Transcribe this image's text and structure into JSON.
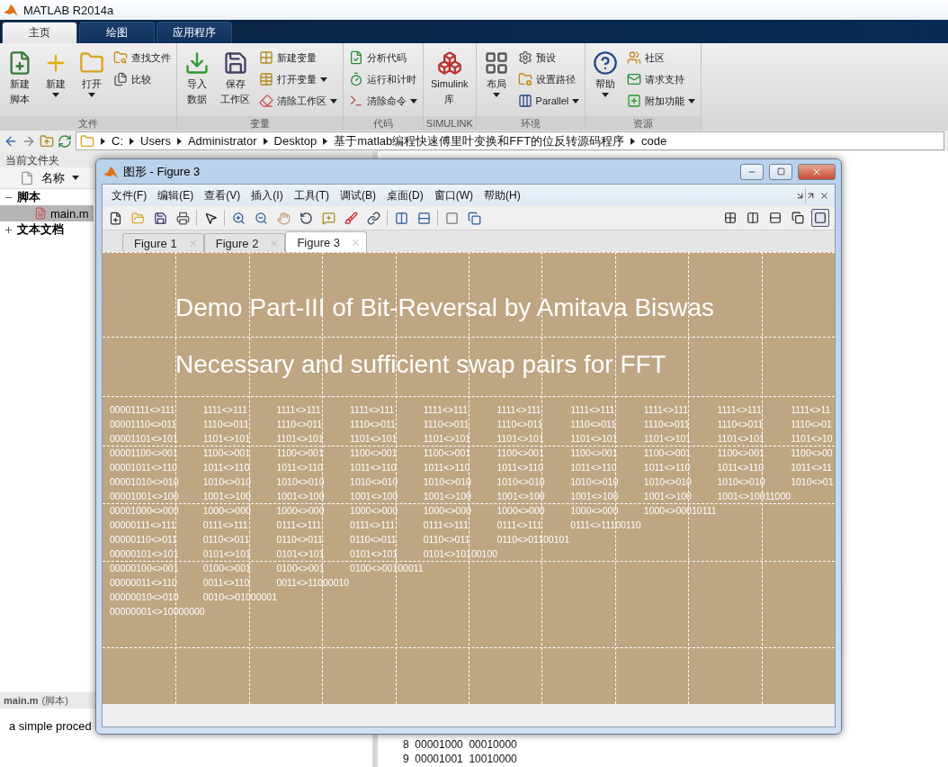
{
  "window": {
    "title": "MATLAB R2014a"
  },
  "ribbon_tabs": [
    {
      "label": "主页",
      "selected": true
    },
    {
      "label": "绘图",
      "selected": false
    },
    {
      "label": "应用程序",
      "selected": false
    }
  ],
  "ribbon_groups": [
    {
      "label": "文件",
      "items": [
        {
          "kind": "large",
          "lines": [
            "新建",
            "脚本"
          ],
          "dropdown": false
        },
        {
          "kind": "large",
          "lines": [
            "新建"
          ],
          "dropdown": true
        },
        {
          "kind": "large",
          "lines": [
            "打开"
          ],
          "dropdown": true
        },
        {
          "kind": "stack",
          "items": [
            {
              "label": "查找文件",
              "dropdown": false
            },
            {
              "label": "比较",
              "dropdown": false
            }
          ]
        }
      ]
    },
    {
      "label": "变量",
      "items": [
        {
          "kind": "large",
          "lines": [
            "导入",
            "数据"
          ],
          "dropdown": false
        },
        {
          "kind": "large",
          "lines": [
            "保存",
            "工作区"
          ],
          "dropdown": false
        },
        {
          "kind": "stack",
          "items": [
            {
              "label": "新建变量",
              "dropdown": false
            },
            {
              "label": "打开变量",
              "dropdown": true
            },
            {
              "label": "清除工作区",
              "dropdown": true
            }
          ]
        }
      ]
    },
    {
      "label": "代码",
      "items": [
        {
          "kind": "stack",
          "items": [
            {
              "label": "分析代码",
              "dropdown": false
            },
            {
              "label": "运行和计时",
              "dropdown": false
            },
            {
              "label": "清除命令",
              "dropdown": true
            }
          ]
        }
      ]
    },
    {
      "label": "SIMULINK",
      "items": [
        {
          "kind": "large",
          "lines": [
            "Simulink",
            "库"
          ],
          "dropdown": false
        }
      ]
    },
    {
      "label": "环境",
      "items": [
        {
          "kind": "large",
          "lines": [
            "布局"
          ],
          "dropdown": true
        },
        {
          "kind": "stack",
          "items": [
            {
              "label": "预设",
              "dropdown": false
            },
            {
              "label": "设置路径",
              "dropdown": false
            },
            {
              "label": "Parallel",
              "dropdown": true
            }
          ]
        }
      ]
    },
    {
      "label": "资源",
      "items": [
        {
          "kind": "large",
          "lines": [
            "帮助"
          ],
          "dropdown": true
        },
        {
          "kind": "stack",
          "items": [
            {
              "label": "社区",
              "dropdown": false
            },
            {
              "label": "请求支持",
              "dropdown": false
            },
            {
              "label": "附加功能",
              "dropdown": true
            }
          ]
        }
      ]
    }
  ],
  "address_path": [
    "C:",
    "Users",
    "Administrator",
    "Desktop",
    "基于matlab编程快速傅里叶变换和FFT的位反转源码程序",
    "code"
  ],
  "current_folder": {
    "title": "当前文件夹",
    "column": "名称",
    "tree": [
      {
        "label": "脚本",
        "expanded": true,
        "selected": false,
        "children": [
          {
            "label": "main.m",
            "selected": true
          }
        ]
      },
      {
        "label": "文本文档",
        "expanded": false,
        "selected": false
      }
    ]
  },
  "details": {
    "file": "main.m",
    "type": "(脚本)",
    "text": "a simple proced"
  },
  "command_window": {
    "lines": [
      "8  00001000  00010000",
      "9  00001001  10010000"
    ]
  },
  "figure_window": {
    "title": "图形 - Figure 3",
    "menus": [
      "文件(F)",
      "编辑(E)",
      "查看(V)",
      "插入(I)",
      "工具(T)",
      "调试(B)",
      "桌面(D)",
      "窗口(W)",
      "帮助(H)"
    ],
    "tabs": [
      {
        "label": "Figure 1",
        "selected": false
      },
      {
        "label": "Figure 2",
        "selected": false
      },
      {
        "label": "Figure 3",
        "selected": true
      }
    ],
    "plot": {
      "titles": [
        "Demo Part-III of Bit-Reversal by Amitava Biswas",
        "Necessary and sufficient swap pairs for FFT"
      ],
      "rows": [
        [
          "00001111<>111",
          "1111<>111",
          "1111<>111",
          "1111<>111",
          "1111<>111",
          "1111<>111",
          "1111<>111",
          "1111<>111",
          "1111<>111",
          "1111<>11"
        ],
        [
          "00001110<>011",
          "1110<>011",
          "1110<>011",
          "1110<>011",
          "1110<>011",
          "1110<>011",
          "1110<>011",
          "1110<>011",
          "1110<>011",
          "1110<>01"
        ],
        [
          "00001101<>101",
          "1101<>101",
          "1101<>101",
          "1101<>101",
          "1101<>101",
          "1101<>101",
          "1101<>101",
          "1101<>101",
          "1101<>101",
          "1101<>10"
        ],
        [
          "00001100<>001",
          "1100<>001",
          "1100<>001",
          "1100<>001",
          "1100<>001",
          "1100<>001",
          "1100<>001",
          "1100<>001",
          "1100<>001",
          "1100<>00"
        ],
        [
          "00001011<>110",
          "1011<>110",
          "1011<>110",
          "1011<>110",
          "1011<>110",
          "1011<>110",
          "1011<>110",
          "1011<>110",
          "1011<>110",
          "1011<>11"
        ],
        [
          "00001010<>010",
          "1010<>010",
          "1010<>010",
          "1010<>010",
          "1010<>010",
          "1010<>010",
          "1010<>010",
          "1010<>010",
          "1010<>010",
          "1010<>01"
        ],
        [
          "00001001<>100",
          "1001<>100",
          "1001<>100",
          "1001<>100",
          "1001<>100",
          "1001<>100",
          "1001<>100",
          "1001<>100",
          "1001<>10011000"
        ],
        [
          "00001000<>000",
          "1000<>000",
          "1000<>000",
          "1000<>000",
          "1000<>000",
          "1000<>000",
          "1000<>000",
          "1000<>00010111"
        ],
        [
          "00000111<>111",
          "0111<>111",
          "0111<>111",
          "0111<>111",
          "0111<>111",
          "0111<>111",
          "0111<>11100110"
        ],
        [
          "00000110<>011",
          "0110<>011",
          "0110<>011",
          "0110<>011",
          "0110<>011",
          "0110<>01100101"
        ],
        [
          "00000101<>101",
          "0101<>101",
          "0101<>101",
          "0101<>101",
          "0101<>10100100"
        ],
        [
          "00000100<>001",
          "0100<>001",
          "0100<>001",
          "0100<>00100011"
        ],
        [
          "00000011<>110",
          "0011<>110",
          "0011<>11000010"
        ],
        [
          "00000010<>010",
          "0010<>01000001"
        ],
        [
          "00000001<>10000000"
        ]
      ]
    }
  }
}
